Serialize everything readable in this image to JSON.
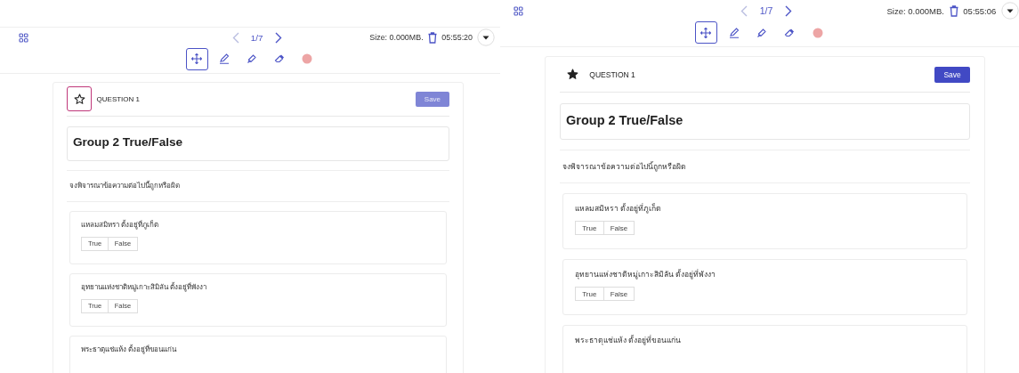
{
  "panels": [
    {
      "pager": "1/7",
      "size": "Size: 0.000MB.",
      "time": "05:55:20",
      "tools": [
        {
          "kind": "move",
          "selected": true
        },
        {
          "kind": "pen",
          "selected": false
        },
        {
          "kind": "highlighter",
          "selected": false
        },
        {
          "kind": "eraser",
          "selected": false
        },
        {
          "kind": "color",
          "selected": false
        }
      ],
      "question_label": "QUESTION 1",
      "starred": false,
      "star_focused": true,
      "save": {
        "label": "Save",
        "disabled": true
      },
      "group_title": "Group 2 True/False",
      "instruction": "จงพิจารณาข้อความต่อไปนี้ถูกหรือผิด",
      "questions": [
        {
          "text": "แหลมสมิหรา ตั้งอยู่ที่ภูเก็ต",
          "choices": [
            "True",
            "False"
          ]
        },
        {
          "text": "อุทยานแห่งชาติหมู่เกาะสิมิลัน ตั้งอยู่ที่พังงา",
          "choices": [
            "True",
            "False"
          ]
        },
        {
          "text": "พระธาตุแช่แห้ง ตั้งอยู่ที่ขอนแก่น"
        }
      ]
    },
    {
      "pager": "1/7",
      "size": "Size: 0.000MB.",
      "time": "05:55:06",
      "tools": [
        {
          "kind": "move",
          "selected": true
        },
        {
          "kind": "pen",
          "selected": false
        },
        {
          "kind": "highlighter",
          "selected": false
        },
        {
          "kind": "eraser",
          "selected": false
        },
        {
          "kind": "color",
          "selected": false
        }
      ],
      "question_label": "QUESTION 1",
      "starred": true,
      "star_focused": false,
      "save": {
        "label": "Save",
        "disabled": false
      },
      "group_title": "Group 2 True/False",
      "instruction": "จงพิจารณาข้อความต่อไปนี้ถูกหรือผิด",
      "questions": [
        {
          "text": "แหลมสมิหรา ตั้งอยู่ที่ภูเก็ต",
          "choices": [
            "True",
            "False"
          ]
        },
        {
          "text": "อุทยานแห่งชาติหมู่เกาะสิมิลัน ตั้งอยู่ที่พังงา",
          "choices": [
            "True",
            "False"
          ]
        },
        {
          "text": "พระธาตุแช่แห้ง ตั้งอยู่ที่ขอนแก่น"
        }
      ]
    }
  ]
}
